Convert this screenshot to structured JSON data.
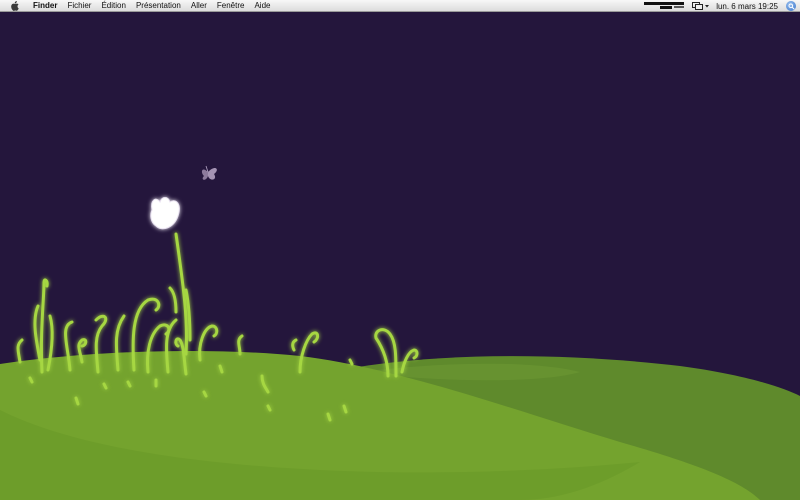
{
  "menubar": {
    "apple_icon": "apple-logo-icon",
    "app_name": "Finder",
    "items": [
      "Fichier",
      "Édition",
      "Présentation",
      "Aller",
      "Fenêtre",
      "Aide"
    ],
    "clock": "lun. 6 mars 19:25",
    "status_icons": [
      "battery-meter-icon",
      "display-mirroring-icon",
      "spotlight-icon"
    ]
  },
  "desktop": {
    "wallpaper": "night-meadow-tulip",
    "colors": {
      "sky": "#24163c",
      "grass_front": "#74a32e",
      "grass_back": "#5f8a2c",
      "plant_glow": "#a6d742"
    }
  }
}
